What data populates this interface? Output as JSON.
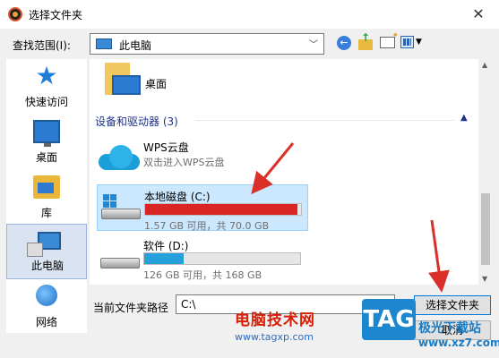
{
  "window": {
    "title": "选择文件夹",
    "close_glyph": "✕"
  },
  "toolbar": {
    "lookin_label": "查找范围(I):",
    "lookin_value": "此电脑",
    "icons": [
      "back-icon",
      "up-folder-icon",
      "new-folder-icon",
      "view-menu-icon"
    ]
  },
  "places": [
    {
      "label": "快速访问",
      "icon": "star-icon"
    },
    {
      "label": "桌面",
      "icon": "desktop-icon"
    },
    {
      "label": "库",
      "icon": "library-icon"
    },
    {
      "label": "此电脑",
      "icon": "computer-icon",
      "selected": true
    },
    {
      "label": "网络",
      "icon": "network-icon"
    }
  ],
  "filelist": {
    "desktop_item": "桌面",
    "group_header": "设备和驱动器 (3)",
    "items": [
      {
        "name": "WPS云盘",
        "sub": "双击进入WPS云盘"
      },
      {
        "name": "本地磁盘 (C:)",
        "space": "1.57 GB 可用，共 70.0 GB",
        "used_fraction": 0.978,
        "bar_color": "#da2525"
      },
      {
        "name": "软件 (D:)",
        "space": "126 GB 可用，共 168 GB",
        "used_fraction": 0.25,
        "bar_color": "#26a0da"
      }
    ]
  },
  "footer": {
    "path_label": "当前文件夹路径",
    "path_value": "C:\\",
    "select_button": "选择文件夹",
    "cancel_button": "取消"
  },
  "watermark": {
    "text": "电脑技术网",
    "url": "www.tagxp.com",
    "badge": "TAG",
    "side_text": "极光下载站",
    "side_url": "www.xz7.com"
  },
  "colors": {
    "accent": "#0078d7",
    "annotation_arrow": "#d9302a"
  }
}
